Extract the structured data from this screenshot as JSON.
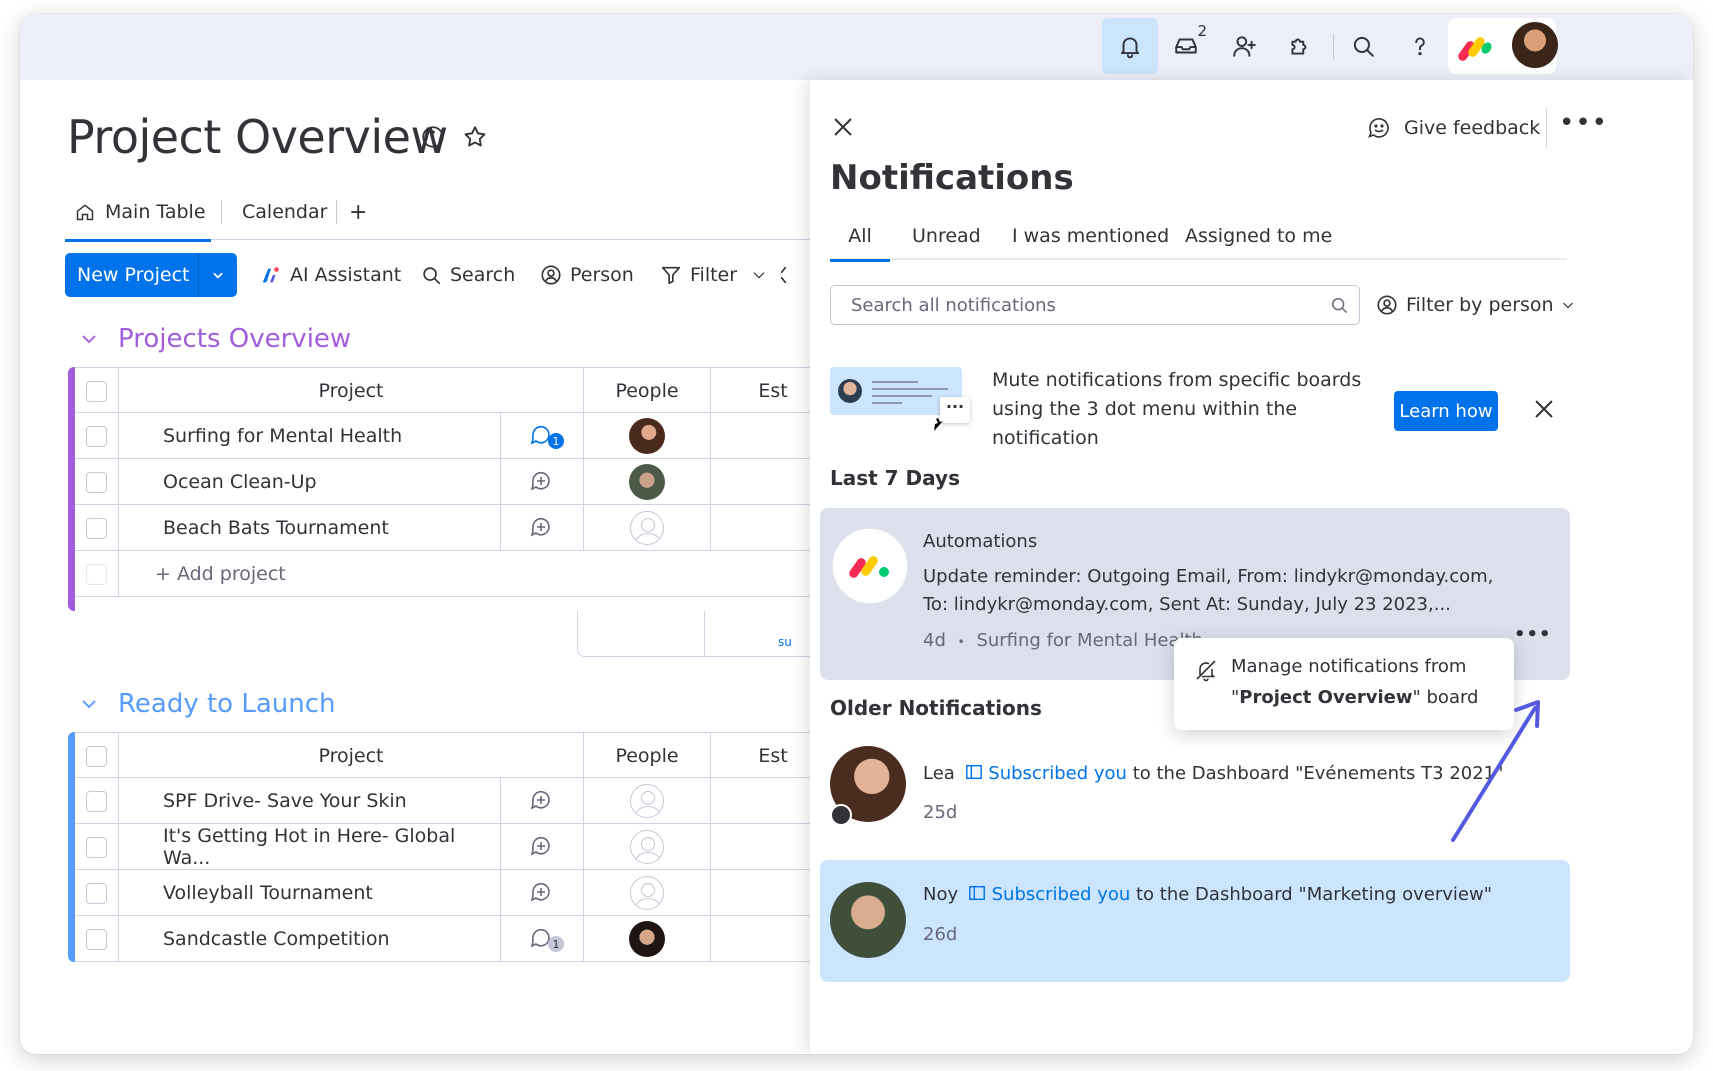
{
  "topbar": {
    "inbox_badge": "2",
    "icons": [
      "bell-icon",
      "inbox-icon",
      "invite-members-icon",
      "integrations-icon",
      "search-icon",
      "help-icon"
    ]
  },
  "board": {
    "title": "Project Overview",
    "tabs": [
      {
        "label": "Main Table"
      },
      {
        "label": "Calendar"
      },
      {
        "label": "+"
      }
    ],
    "new_button": "New Project",
    "toolbar": {
      "ai": "AI Assistant",
      "search": "Search",
      "person": "Person",
      "filter": "Filter"
    },
    "groups": [
      {
        "title": "Projects Overview",
        "color": "#a25ddc",
        "columns": {
          "project": "Project",
          "people": "People",
          "est": "Est"
        },
        "rows": [
          {
            "name": "Surfing for Mental Health",
            "updates": "1",
            "person": "photo"
          },
          {
            "name": "Ocean Clean-Up",
            "updates": "",
            "person": "photo"
          },
          {
            "name": "Beach Bats Tournament",
            "updates": "",
            "person": "empty"
          }
        ],
        "add_label": "+ Add project",
        "summary_fragment": "su"
      },
      {
        "title": "Ready to Launch",
        "color": "#579bfc",
        "columns": {
          "project": "Project",
          "people": "People",
          "est": "Est"
        },
        "rows": [
          {
            "name": "SPF Drive- Save Your Skin",
            "updates": "",
            "person": "empty"
          },
          {
            "name": "It's Getting Hot in Here- Global Wa...",
            "updates": "",
            "person": "empty"
          },
          {
            "name": "Volleyball Tournament",
            "updates": "",
            "person": "empty"
          },
          {
            "name": "Sandcastle Competition",
            "updates": "1",
            "person": "photo"
          }
        ]
      }
    ]
  },
  "notifications": {
    "give_feedback": "Give feedback",
    "more": "•••",
    "title": "Notifications",
    "tabs": [
      {
        "label": "All"
      },
      {
        "label": "Unread"
      },
      {
        "label": "I was mentioned"
      },
      {
        "label": "Assigned to me"
      }
    ],
    "search_placeholder": "Search all notifications",
    "filter_label": "Filter by person",
    "tip": {
      "text": "Mute notifications from specific boards using the 3 dot menu within the notification",
      "button": "Learn how",
      "image_dots": "···"
    },
    "sections": {
      "recent": "Last 7 Days",
      "older": "Older Notifications"
    },
    "items": [
      {
        "sender": "Automations",
        "message": "Update reminder: Outgoing Email, From: lindykr@monday.com, To: lindykr@monday.com, Sent At: Sunday, July 23 2023,...",
        "age": "4d",
        "separator": "•",
        "item": "Surfing for Mental Health",
        "dots": "•••"
      },
      {
        "sender": "Lea",
        "action": "Subscribed you",
        "rest": "to the Dashboard \"Evénements T3 2021\"",
        "age": "25d"
      },
      {
        "sender": "Noy",
        "action": "Subscribed you",
        "rest": "to the Dashboard \"Marketing overview\"",
        "age": "26d"
      }
    ],
    "tooltip": {
      "line1": "Manage notifications from",
      "quote_open": "\"",
      "board": "Project Overview",
      "quote_close": "\"",
      "suffix": " board"
    }
  },
  "colors": {
    "accent": "#0073ea",
    "selected_bg": "#cce5ff",
    "hover_bg": "#dcdfec",
    "arrow": "#5559df"
  }
}
